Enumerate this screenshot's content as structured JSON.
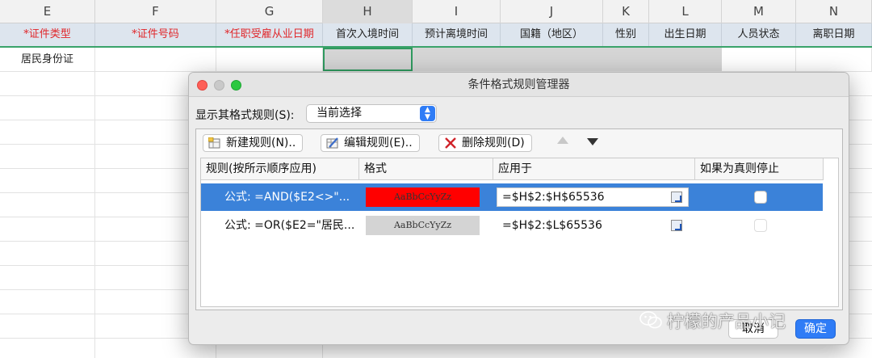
{
  "sheet": {
    "columns": [
      "E",
      "F",
      "G",
      "H",
      "I",
      "J",
      "K",
      "L",
      "M",
      "N"
    ],
    "headers": [
      {
        "text": "*证件类型",
        "required": true
      },
      {
        "text": "*证件号码",
        "required": true
      },
      {
        "text": "*任职受雇从业日期",
        "required": true
      },
      {
        "text": "首次入境时间",
        "required": false
      },
      {
        "text": "预计离境时间",
        "required": false
      },
      {
        "text": "国籍（地区）",
        "required": false
      },
      {
        "text": "性别",
        "required": false
      },
      {
        "text": "出生日期",
        "required": false
      },
      {
        "text": "人员状态",
        "required": false
      },
      {
        "text": "离职日期",
        "required": false
      }
    ],
    "row1_e": "居民身份证"
  },
  "dialog": {
    "title": "条件格式规则管理器",
    "show_rules_label": "显示其格式规则(S):",
    "show_rules_value": "当前选择",
    "toolbar": {
      "new_rule": "新建规则(N)..",
      "edit_rule": "编辑规则(E)..",
      "delete_rule": "删除规则(D)"
    },
    "table": {
      "headers": [
        "规则(按所示顺序应用)",
        "格式",
        "应用于",
        "如果为真则停止"
      ],
      "rows": [
        {
          "rule": "公式: =AND($E2<>\"...",
          "preview": "AaBbCcYyZz",
          "preview_bg": "#ff0000",
          "applies_to": "=$H$2:$H$65536",
          "stop": false
        },
        {
          "rule": "公式: =OR($E2=\"居民...",
          "preview": "AaBbCcYyZz",
          "preview_bg": "#d4d4d4",
          "applies_to": "=$H$2:$L$65536",
          "stop": false
        }
      ]
    },
    "cancel": "取消",
    "ok": "确定"
  },
  "watermark": "柠檬的产品小记",
  "colors": {
    "accent": "#2f7cf6",
    "selection": "#3b82d9",
    "required": "#e0262a"
  }
}
